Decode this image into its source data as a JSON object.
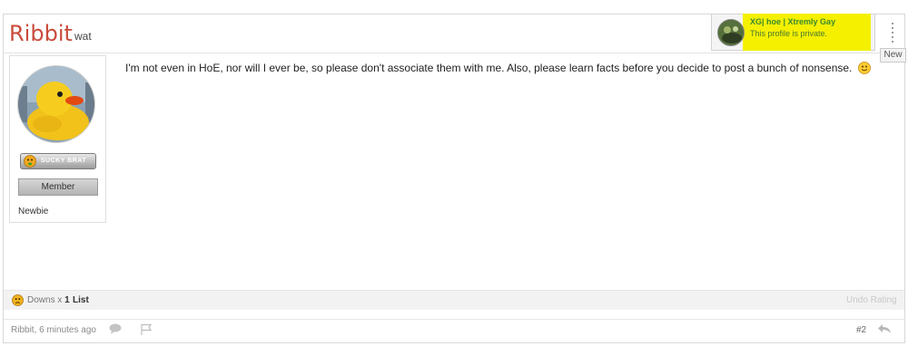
{
  "post": {
    "username": "Ribbit",
    "user_title": "wat",
    "new_label": "New",
    "message": "I'm not even in HoE, nor will I ever be, so please don't associate them with me. Also, please learn facts before you decide to post a bunch of nonsense.",
    "post_number": "#2"
  },
  "profile_card": {
    "name": "XG| hoe | Xtremly Gay",
    "status": "This profile is private."
  },
  "sidebar": {
    "rank_badge": "SUCKY BRAT",
    "member_label": "Member",
    "rank_title": "Newbie"
  },
  "rating": {
    "label": "Downs x",
    "count": "1",
    "list_link": "List",
    "undo_link": "Undo Rating"
  },
  "footer": {
    "author_time": "Ribbit, 6 minutes ago"
  },
  "colors": {
    "username": "#c94b3b",
    "highlight": "#f4f000",
    "profile_name": "#3a8a2f"
  },
  "icons": [
    "duck-avatar",
    "sad-face-icon",
    "smiley-icon",
    "comment-icon",
    "flag-icon",
    "reply-icon",
    "drag-grip-icon"
  ]
}
